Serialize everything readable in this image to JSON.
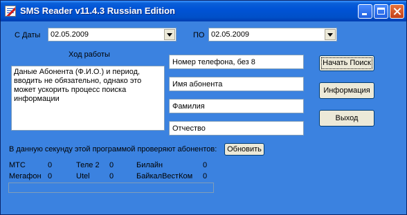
{
  "window": {
    "title": "SMS Reader v11.4.3 Russian Edition"
  },
  "dates": {
    "from_label": "С Даты",
    "from_value": "02.05.2009",
    "to_label": "ПО",
    "to_value": "02.05.2009"
  },
  "progress_label": "Ход работы",
  "memo_text": "Даные Абонента (Ф.И.О.) и период, вводить не обязательно, однако это может ускорить процесс поиска информации",
  "fields": {
    "phone": "Номер телефона, без 8",
    "name": "Имя абонента",
    "surname": "Фамилия",
    "patronymic": "Отчество"
  },
  "buttons": {
    "search": "Начать Поиск",
    "info": "Информация",
    "exit": "Выход",
    "refresh": "Обновить"
  },
  "check_text": "В данную секунду этой программой проверяют абонентов:",
  "stats": {
    "mts": {
      "name": "МТС",
      "count": "0"
    },
    "tele2": {
      "name": "Теле 2",
      "count": "0"
    },
    "beeline": {
      "name": "Билайн",
      "count": "0"
    },
    "megafon": {
      "name": "Мегафон",
      "count": "0"
    },
    "utel": {
      "name": "Utel",
      "count": "0"
    },
    "baikal": {
      "name": "БайкалВестКом",
      "count": "0"
    }
  },
  "progress": {
    "fraction": 0
  }
}
